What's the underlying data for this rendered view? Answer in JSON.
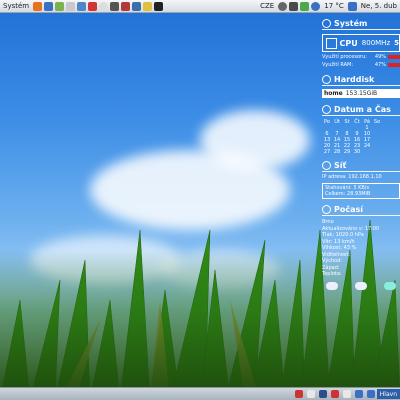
{
  "top_panel": {
    "menus": [
      "Systém"
    ],
    "launchers": [
      "firefox-icon",
      "thunderbird-icon",
      "pidgin-icon",
      "files-icon",
      "text-editor-icon",
      "settings-icon",
      "update-icon",
      "media-icon",
      "camera-icon",
      "screenshot-icon",
      "palette-icon",
      "terminal-icon"
    ],
    "keyboard_layout": "CZE",
    "temperature": "17 °C",
    "datetime": "Ne, 5. dub"
  },
  "conky": {
    "system": {
      "title": "Systém",
      "cpu_label": "CPU",
      "cpu_freq": "800MHz",
      "cpu_extra": "5",
      "cpu_usage_label": "Využití procesoru:",
      "cpu_usage": "49%",
      "ram_usage_label": "Využití RAM:",
      "ram_usage": "47%"
    },
    "harddisk": {
      "title": "Harddisk",
      "mount": "home",
      "free": "153.15GiB"
    },
    "datetime": {
      "title": "Datum a Čas",
      "weekdays": [
        "Po",
        "Út",
        "St",
        "Čt",
        "Pá",
        "So"
      ],
      "rows": [
        [
          "",
          "",
          "",
          "",
          "",
          ""
        ],
        [
          "",
          "",
          "",
          "",
          "1",
          ""
        ],
        [
          "6",
          "7",
          "8",
          "9",
          "10",
          ""
        ],
        [
          "13",
          "14",
          "15",
          "16",
          "17",
          ""
        ],
        [
          "20",
          "21",
          "22",
          "23",
          "24",
          ""
        ],
        [
          "27",
          "28",
          "29",
          "30",
          "",
          ""
        ]
      ]
    },
    "network": {
      "title": "Síť",
      "ip_label": "IP adresa:",
      "ip": "192.168.1.10",
      "download_label": "Stahování:",
      "download": "3",
      "download_unit": "KB/s",
      "total_label": "Celkem:",
      "total": "28.93MiB"
    },
    "weather": {
      "title": "Počasí",
      "lines": [
        "Brno",
        "Aktualizováno v: 17:00",
        "Tlak: 1020.0 hPa",
        "Vítr: 13 km/h",
        "Vlhkost: 43 %",
        "Viditelnost:",
        "Východ:",
        "Západ:",
        "Teplota:"
      ]
    }
  },
  "bottom_panel": {
    "task_label": "Hlavn"
  }
}
